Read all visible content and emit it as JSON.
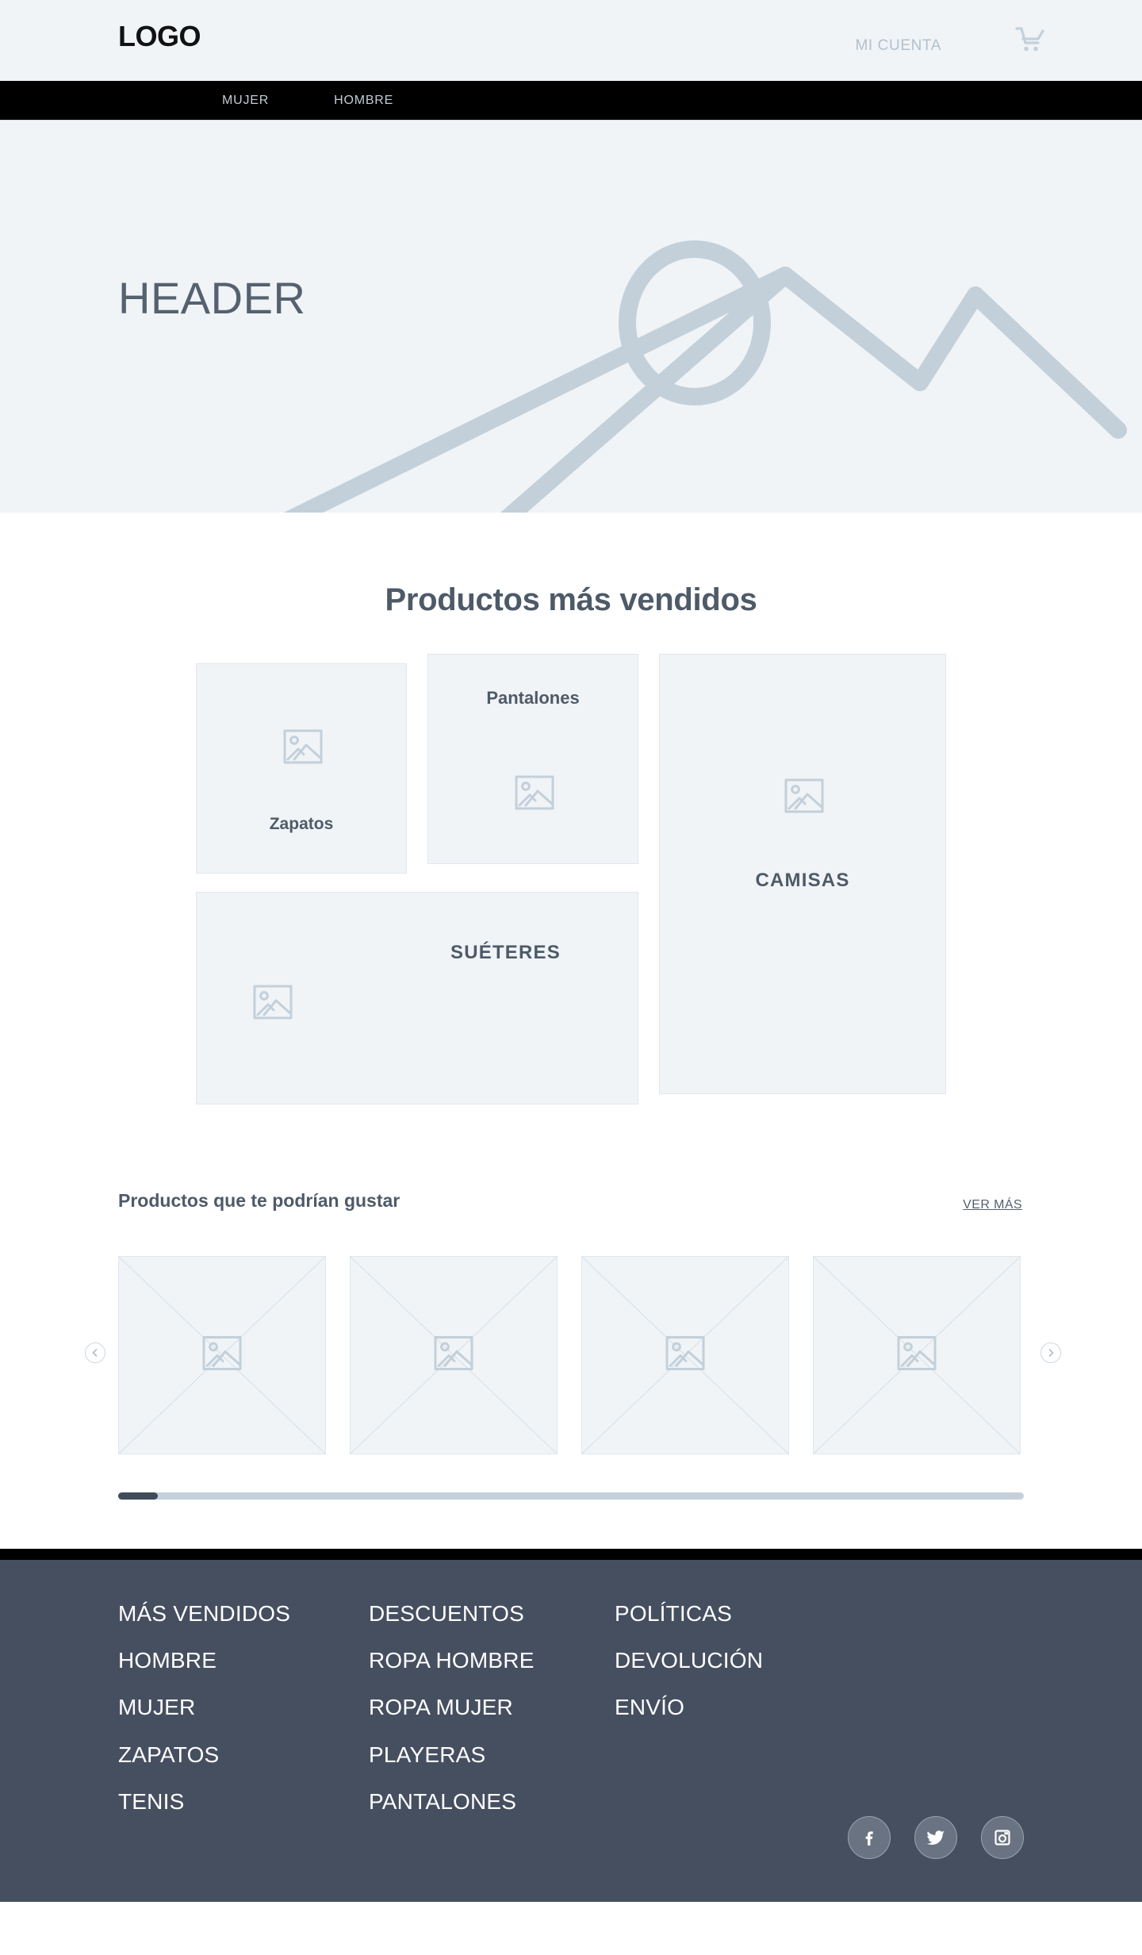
{
  "header": {
    "logo": "LOGO",
    "account_label": "MI CUENTA",
    "cart_icon": "shopping-cart-icon"
  },
  "nav": {
    "items": [
      {
        "label": "MUJER"
      },
      {
        "label": "HOMBRE"
      }
    ]
  },
  "hero": {
    "title": "HEADER",
    "art_icon": "image-placeholder-mountain-icon"
  },
  "bestsellers": {
    "title": "Productos más vendidos",
    "cards": [
      {
        "label": "Zapatos",
        "icon": "image-placeholder-icon"
      },
      {
        "label": "Pantalones",
        "icon": "image-placeholder-icon"
      },
      {
        "label": "CAMISAS",
        "icon": "image-placeholder-icon"
      },
      {
        "label": "SUÉTERES",
        "icon": "image-placeholder-icon"
      }
    ]
  },
  "recommended": {
    "title": "Productos que te podrían gustar",
    "see_more_label": "VER MÁS",
    "prev_icon": "chevron-left-icon",
    "next_icon": "chevron-right-icon",
    "slides": [
      {
        "icon": "image-placeholder-icon"
      },
      {
        "icon": "image-placeholder-icon"
      },
      {
        "icon": "image-placeholder-icon"
      },
      {
        "icon": "image-placeholder-icon"
      }
    ],
    "scroll_position_percent": 4
  },
  "footer": {
    "columns": [
      {
        "links": [
          {
            "label": "MÁS VENDIDOS"
          },
          {
            "label": "HOMBRE"
          },
          {
            "label": "MUJER"
          },
          {
            "label": "ZAPATOS"
          },
          {
            "label": "TENIS"
          }
        ]
      },
      {
        "links": [
          {
            "label": "DESCUENTOS"
          },
          {
            "label": "ROPA HOMBRE"
          },
          {
            "label": "ROPA MUJER"
          },
          {
            "label": "PLAYERAS"
          },
          {
            "label": "PANTALONES"
          }
        ]
      },
      {
        "links": [
          {
            "label": "POLÍTICAS"
          },
          {
            "label": "DEVOLUCIÓN"
          },
          {
            "label": "ENVÍO"
          }
        ]
      }
    ],
    "socials": [
      {
        "icon": "facebook-icon"
      },
      {
        "icon": "twitter-icon"
      },
      {
        "icon": "instagram-icon"
      }
    ]
  },
  "colors": {
    "nav_bar": "#000000",
    "surface_light": "#f0f4f7",
    "placeholder_stroke": "#c3d0da",
    "text_dark": "#4e5a68",
    "footer_bg": "#464f60",
    "scroll_thumb": "#414c5a"
  }
}
